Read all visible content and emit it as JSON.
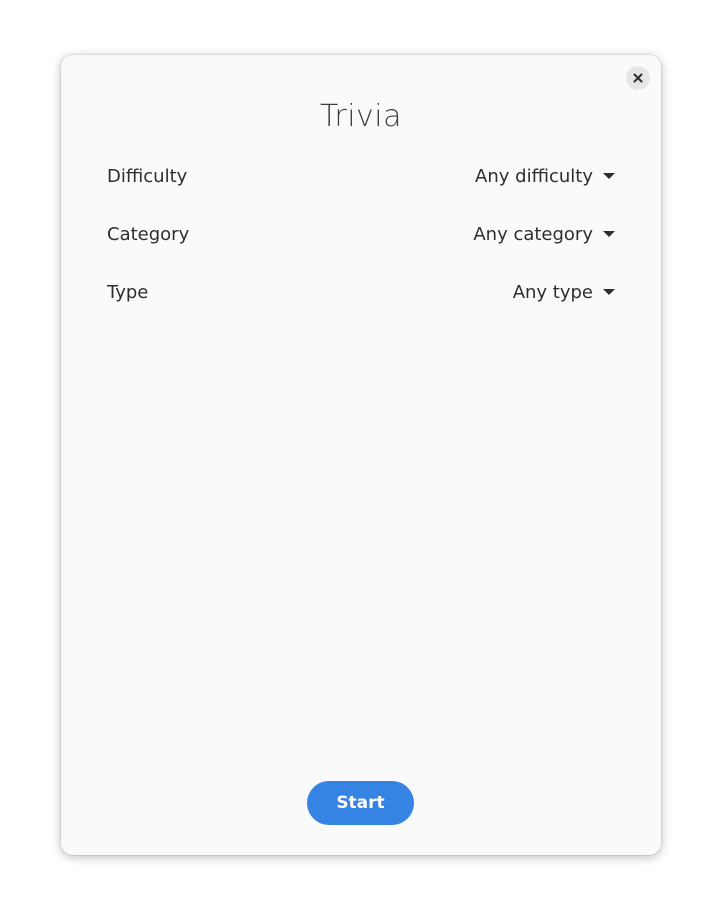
{
  "window": {
    "title": "Trivia"
  },
  "settings": {
    "rows": [
      {
        "label": "Difficulty",
        "value": "Any difficulty"
      },
      {
        "label": "Category",
        "value": "Any category"
      },
      {
        "label": "Type",
        "value": "Any type"
      }
    ]
  },
  "actions": {
    "start_label": "Start"
  },
  "icons": {
    "close": "close-icon",
    "dropdown": "pan-down-icon"
  },
  "colors": {
    "accent": "#3584e4",
    "window_bg": "#fafafa"
  }
}
